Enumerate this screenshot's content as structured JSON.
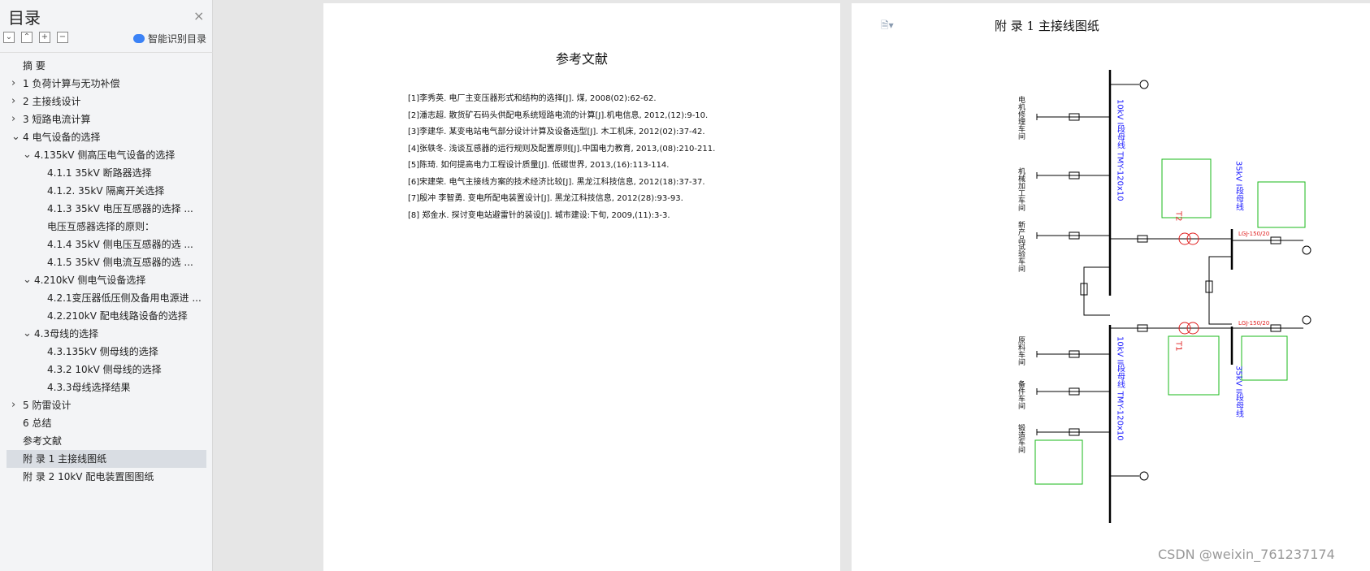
{
  "sidebar": {
    "title": "目录",
    "close": "×",
    "tools": [
      "⌄",
      "⌃",
      "+",
      "−"
    ],
    "smart_label": "智能识别目录",
    "items": [
      {
        "label": "摘  要",
        "level": 0,
        "chev": ""
      },
      {
        "label": "1   负荷计算与无功补偿",
        "level": 0,
        "chev": "›"
      },
      {
        "label": "2   主接线设计",
        "level": 0,
        "chev": "›"
      },
      {
        "label": "3   短路电流计算",
        "level": 0,
        "chev": "›"
      },
      {
        "label": "4   电气设备的选择",
        "level": 0,
        "chev": "⌄"
      },
      {
        "label": "4.135kV 侧高压电气设备的选择",
        "level": 1,
        "chev": "⌄"
      },
      {
        "label": "4.1.1    35kV 断路器选择",
        "level": 2,
        "chev": ""
      },
      {
        "label": "4.1.2. 35kV 隔离开关选择",
        "level": 2,
        "chev": ""
      },
      {
        "label": "4.1.3    35kV 电压互感器的选择 ...",
        "level": 2,
        "chev": ""
      },
      {
        "label": "电压互感器选择的原则：",
        "level": 2,
        "chev": ""
      },
      {
        "label": "4.1.4    35kV 侧电压互感器的选 ...",
        "level": 2,
        "chev": ""
      },
      {
        "label": "4.1.5    35kV 侧电流互感器的选 ...",
        "level": 2,
        "chev": ""
      },
      {
        "label": "4.210kV 侧电气设备选择",
        "level": 1,
        "chev": "⌄"
      },
      {
        "label": "4.2.1变压器低压侧及备用电源进 ...",
        "level": 2,
        "chev": ""
      },
      {
        "label": "4.2.210kV 配电线路设备的选择",
        "level": 2,
        "chev": ""
      },
      {
        "label": "4.3母线的选择",
        "level": 1,
        "chev": "⌄"
      },
      {
        "label": "4.3.135kV 侧母线的选择",
        "level": 2,
        "chev": ""
      },
      {
        "label": "4.3.2  10kV 侧母线的选择",
        "level": 2,
        "chev": ""
      },
      {
        "label": "4.3.3母线选择结果",
        "level": 2,
        "chev": ""
      },
      {
        "label": "5   防雷设计",
        "level": 0,
        "chev": "›"
      },
      {
        "label": "6   总结",
        "level": 0,
        "chev": ""
      },
      {
        "label": "参考文献",
        "level": 0,
        "chev": ""
      },
      {
        "label": "附   录 1  主接线图纸",
        "level": 0,
        "chev": "",
        "active": true
      },
      {
        "label": "附   录 2 10kV 配电装置图图纸",
        "level": 0,
        "chev": ""
      }
    ]
  },
  "page1": {
    "title": "参考文献",
    "refs": [
      "[1]李秀英. 电厂主变压器形式和结构的选择[J]. 煤, 2008(02):62-62.",
      "[2]潘志超. 散货矿石码头供配电系统短路电流的计算[J].机电信息, 2012,(12):9-10.",
      "[3]李建华. 某变电站电气部分设计计算及设备选型[J]. 木工机床, 2012(02):37-42.",
      "[4]张轶冬. 浅谈互感器的运行规则及配置原则[J].中国电力教育, 2013,(08):210-211.",
      "[5]陈琦. 如何提高电力工程设计质量[J]. 低碳世界, 2013,(16):113-114.",
      "[6]宋建荣. 电气主接线方案的技术经济比较[J]. 黑龙江科技信息, 2012(18):37-37.",
      "[7]殷冲  李智勇. 变电所配电装置设计[J]. 黑龙江科技信息, 2012(28):93-93.",
      "[8] 郑金水. 探讨变电站避雷针的装设[J]. 城市建设:下旬, 2009,(11):3-3."
    ]
  },
  "page2": {
    "doc_icon": "🗎▾",
    "title": "附    录 1  主接线图纸",
    "feeders_top": [
      "电机修理车间",
      "机械加工车间",
      "新产品试验车间"
    ],
    "feeders_bottom": [
      "原料车间",
      "备件车间",
      "锻造车间"
    ],
    "bus_top": "10kV I段母线 TMY-120x10",
    "bus_bottom": "10kV II段母线 TMY-120x10",
    "bus35_top": "35kV I段母线",
    "bus35_bottom": "35kV II段母线",
    "t2": "T2",
    "t1": "T1",
    "line_label": "LGJ-150/20",
    "colors": {
      "bus": "#000000",
      "label_blue": "#1a1aff",
      "label_red": "#e02020",
      "equip_green": "#18b818"
    }
  },
  "watermark": "CSDN @weixin_761237174"
}
